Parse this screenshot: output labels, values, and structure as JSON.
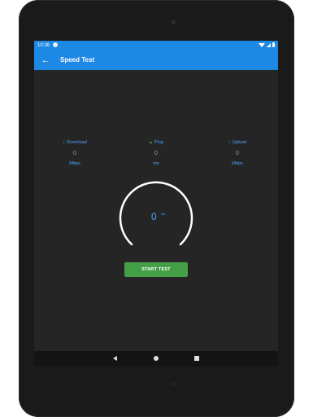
{
  "status_bar": {
    "time": "10:36"
  },
  "app_bar": {
    "title": "Speed Test",
    "back_icon": "arrow-back-icon"
  },
  "metrics": [
    {
      "icon": "download-arrow-icon",
      "label": "Download",
      "value": "0",
      "unit": "Mbps"
    },
    {
      "icon": "ping-icon",
      "label": "Ping",
      "value": "0",
      "unit": "ms"
    },
    {
      "icon": "upload-arrow-icon",
      "label": "Upload",
      "value": "0",
      "unit": "Mbps"
    }
  ],
  "gauge": {
    "value": "0",
    "unit": "ms"
  },
  "start_button": {
    "label": "START TEST"
  },
  "colors": {
    "accent": "#1e88e5",
    "link": "#4da3ff",
    "button": "#43a047",
    "background": "#252525"
  }
}
